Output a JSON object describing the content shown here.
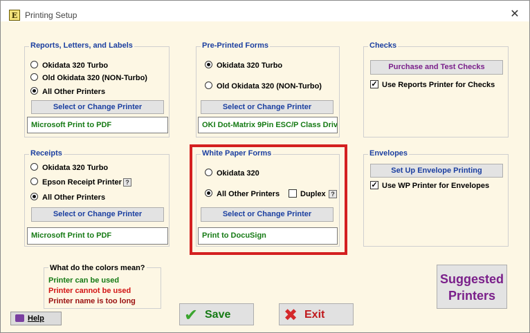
{
  "window": {
    "title": "Printing Setup"
  },
  "groups": {
    "reports": {
      "title": "Reports, Letters, and Labels",
      "options": [
        "Okidata 320 Turbo",
        "Old Okidata 320 (NON-Turbo)",
        "All Other Printers"
      ],
      "button": "Select or Change Printer",
      "printer": "Microsoft Print to PDF"
    },
    "preprinted": {
      "title": "Pre-Printed Forms",
      "options": [
        "Okidata 320 Turbo",
        "Old Okidata 320 (NON-Turbo)"
      ],
      "button": "Select or Change Printer",
      "printer": "OKI Dot-Matrix 9Pin ESC/P Class Driv"
    },
    "checks": {
      "title": "Checks",
      "button": "Purchase and Test Checks",
      "checkbox": "Use Reports Printer for Checks"
    },
    "receipts": {
      "title": "Receipts",
      "options": [
        "Okidata 320 Turbo",
        "Epson Receipt Printer",
        "All Other Printers"
      ],
      "button": "Select or Change Printer",
      "printer": "Microsoft Print to PDF"
    },
    "whitepaper": {
      "title": "White Paper Forms",
      "options": [
        "Okidata 320",
        "All Other Printers"
      ],
      "duplex": "Duplex",
      "button": "Select or Change Printer",
      "printer": "Print to DocuSign"
    },
    "envelopes": {
      "title": "Envelopes",
      "button": "Set Up Envelope Printing",
      "checkbox": "Use WP Printer for Envelopes"
    }
  },
  "legend": {
    "title": "What do the colors mean?",
    "can": "Printer can be used",
    "cannot": "Printer cannot be used",
    "toolong": "Printer name is too long"
  },
  "help": "Help",
  "qmark": "?",
  "save": "Save",
  "exit": "Exit",
  "suggested": [
    "Suggested",
    "Printers"
  ],
  "colors": {
    "heading": "#1b3fa0",
    "ok": "#157a14",
    "bad": "#d21414",
    "long": "#9a1010",
    "purple": "#7a1f8a",
    "highlight": "#d42020"
  }
}
